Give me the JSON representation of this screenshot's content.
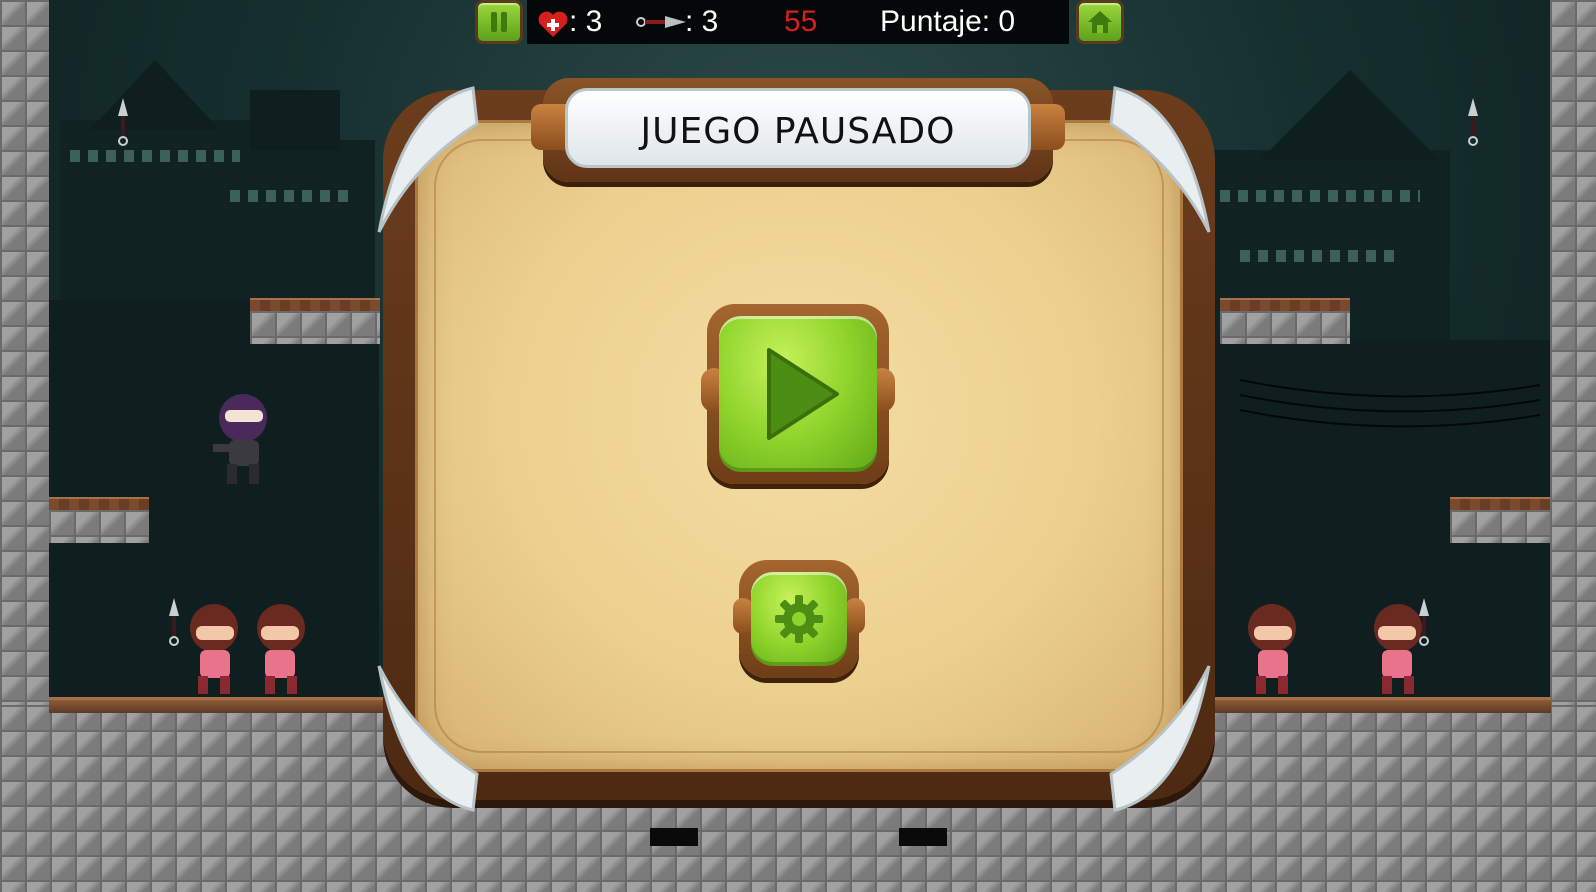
{
  "hud": {
    "lives_label": ": 3",
    "kunai_label": ": 3",
    "timer": "55",
    "score_label": "Puntaje: 0",
    "pause_icon": "pause-icon",
    "home_icon": "home-icon"
  },
  "pause_menu": {
    "title": "JUEGO PAUSADO",
    "resume_icon": "play-icon",
    "settings_icon": "gear-icon"
  },
  "colors": {
    "button_green": "#8fd42c",
    "panel_wood": "#6b3d1c",
    "panel_parchment": "#f4dca2",
    "timer_red": "#d81e1e"
  }
}
